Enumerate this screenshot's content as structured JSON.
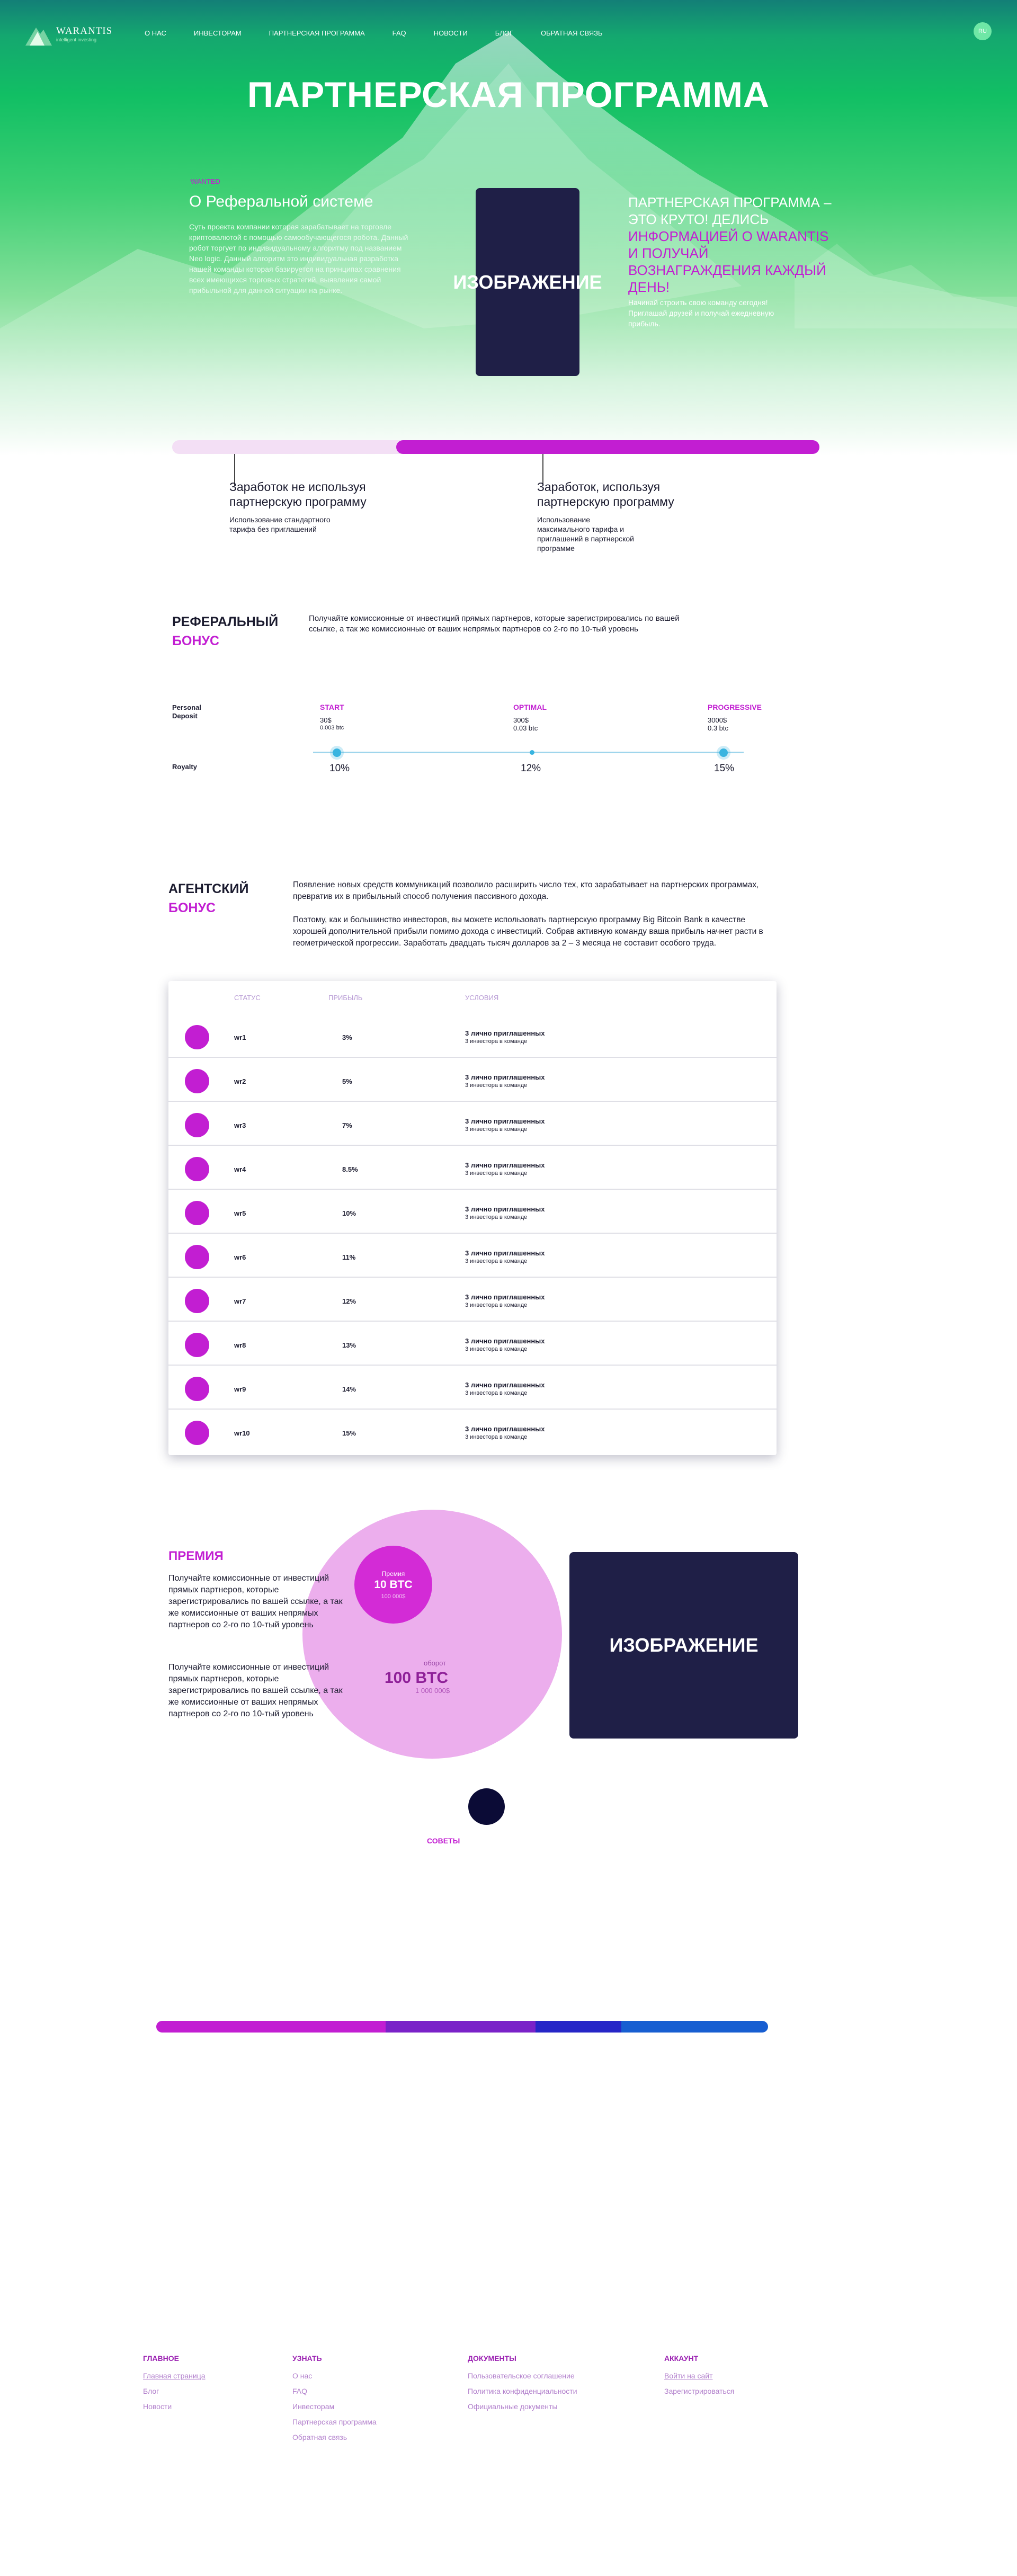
{
  "header": {
    "logo_name": "WARANTIS",
    "logo_sub": "intelligent investing",
    "nav": [
      "О НАС",
      "ИНВЕСТОРАМ",
      "ПАРТНЕРСКАЯ ПРОГРАММА",
      "FAQ",
      "НОВОСТИ",
      "БЛОГ",
      "ОБРАТНАЯ СВЯЗЬ"
    ],
    "lang": "RU"
  },
  "hero": {
    "title": "ПАРТНЕРСКАЯ ПРОГРАММА",
    "about_tag": "WANTED",
    "about_heading": "О Реферальной системе",
    "about_text": "Суть проекта компании которая зарабатывает на торговле криптовалютой с помощью самообучающегося робота. Данный робот торгует по индивидуальному алгоритму под названием Neo logic. Данный алгоритм это индивидуальная разработка нашей команды которая базируется на принципах сравнения всех имеющихся торговых стратегий, выявления самой прибыльной для данной ситуации на рынке.",
    "image_label": "ИЗОБРАЖЕНИЕ",
    "partner_white": "ПАРТНЕРСКАЯ ПРОГРАММА – ЭТО КРУТО! ДЕЛИСЬ",
    "partner_magenta": "ИНФОРМАЦИЕЙ О WARANTIS И ПОЛУЧАЙ ВОЗНАГРАЖДЕНИЯ КАЖДЫЙ ДЕНЬ!",
    "partner_text": "Начинай строить свою команду сегодня! Приглашай друзей и получай ежедневную прибыль."
  },
  "earnings": {
    "progress": 0.65,
    "left_title": "Заработок не используя партнерскую программу",
    "left_text": "Использование стандартного тарифа без приглашений",
    "right_title": "Заработок, используя партнерскую программу",
    "right_text": "Использование максимального тарифа и приглашений в партнерской программе"
  },
  "referral": {
    "title_1": "РЕФЕРАЛЬНЫЙ",
    "title_2": "БОНУС",
    "text": "Получайте комиссионные от инвестиций прямых партнеров, которые зарегистрировались по вашей ссылке, а так же комиссионные  от ваших непрямых партнеров со 2-го по 10-тый уровень",
    "deposit_label": "Personal Deposit",
    "royalty_label": "Royalty",
    "tariffs": [
      {
        "name": "START",
        "usd": "30$",
        "btc": "0.003 btc",
        "royalty": "10%"
      },
      {
        "name": "OPTIMAL",
        "usd": "300$",
        "btc": "0.03 btc",
        "royalty": "12%"
      },
      {
        "name": "PROGRESSIVE",
        "usd": "3000$",
        "btc": "0.3 btc",
        "royalty": "15%"
      }
    ]
  },
  "agent": {
    "title_1": "АГЕНТСКИЙ",
    "title_2": "БОНУС",
    "text_1": "Появление новых средств коммуникаций позволило расширить число тех, кто зарабатывает на партнерских программах, превратив их в прибыльный способ получения пассивного дохода.",
    "text_2": "Поэтому, как и большинство инвесторов, вы можете использовать партнерскую программу Big Bitcoin Bank в качестве хорошей дополнительной прибыли помимо дохода с инвестиций. Собрав активную команду ваша прибыль начнет расти в геометрической прогрессии. Заработать двадцать тысяч долларов за 2 – 3 месяца не составит особого труда.",
    "table": {
      "headers": [
        "СТАТУС",
        "ПРИБЫЛЬ",
        "УСЛОВИЯ"
      ],
      "rows": [
        {
          "status": "wr1",
          "profit": "3%",
          "cond1": "3 лично приглашенных",
          "cond2": "3 инвестора в команде"
        },
        {
          "status": "wr2",
          "profit": "5%",
          "cond1": "3 лично приглашенных",
          "cond2": "3 инвестора в команде"
        },
        {
          "status": "wr3",
          "profit": "7%",
          "cond1": "3 лично приглашенных",
          "cond2": "3 инвестора в команде"
        },
        {
          "status": "wr4",
          "profit": "8.5%",
          "cond1": "3 лично приглашенных",
          "cond2": "3 инвестора в команде"
        },
        {
          "status": "wr5",
          "profit": "10%",
          "cond1": "3 лично приглашенных",
          "cond2": "3 инвестора в команде"
        },
        {
          "status": "wr6",
          "profit": "11%",
          "cond1": "3 лично приглашенных",
          "cond2": "3 инвестора в команде"
        },
        {
          "status": "wr7",
          "profit": "12%",
          "cond1": "3 лично приглашенных",
          "cond2": "3 инвестора в команде"
        },
        {
          "status": "wr8",
          "profit": "13%",
          "cond1": "3 лично приглашенных",
          "cond2": "3 инвестора в команде"
        },
        {
          "status": "wr9",
          "profit": "14%",
          "cond1": "3 лично приглашенных",
          "cond2": "3 инвестора в команде"
        },
        {
          "status": "wr10",
          "profit": "15%",
          "cond1": "3 лично приглашенных",
          "cond2": "3 инвестора в команде"
        }
      ]
    }
  },
  "premium": {
    "title": "ПРЕМИЯ",
    "text_1": "Получайте комиссионные от инвестиций прямых партнеров, которые зарегистрировались по вашей ссылке, а так же комиссионные от ваших непрямых партнеров со 2-го по 10-тый уровень",
    "text_2": "Получайте комиссионные от инвестиций прямых партнеров, которые зарегистрировались по вашей ссылке, а так же комиссионные от ваших непрямых партнеров со 2-го по 10-тый уровень",
    "bonus_label": "Премия",
    "bonus_value": "10 BTC",
    "bonus_usd": "100 000$",
    "turnover_label": "оборот",
    "turnover_value": "100 BTC",
    "turnover_usd": "1 000 000$",
    "image_label": "ИЗОБРАЖЕНИЕ",
    "tips_label": "СОВЕТЫ"
  },
  "multibar": [
    {
      "share": 0.375,
      "color": "#c21ed2"
    },
    {
      "share": 0.245,
      "color": "#7a22c8"
    },
    {
      "share": 0.14,
      "color": "#2626c7"
    },
    {
      "share": 0.24,
      "color": "#175ed1"
    }
  ],
  "footer": {
    "columns": [
      {
        "title": "ГЛАВНОЕ",
        "links": [
          "Главная страница",
          "Блог",
          "Новости"
        ]
      },
      {
        "title": "УЗНАТЬ",
        "links": [
          "О нас",
          "FAQ",
          "Инвесторам",
          "Партнерская программа",
          "Обратная связь"
        ]
      },
      {
        "title": "ДОКУМЕНТЫ",
        "links": [
          "Пользовательское соглашение",
          "Политика конфиденциальности",
          "Официальные документы"
        ]
      },
      {
        "title": "АККАУНТ",
        "links": [
          "Войти на сайт",
          "Зарегистрироваться"
        ]
      }
    ]
  },
  "colors": {
    "accent": "#c21ed2",
    "dark_card": "#1f1f47",
    "hero_green": "#11bf64"
  }
}
